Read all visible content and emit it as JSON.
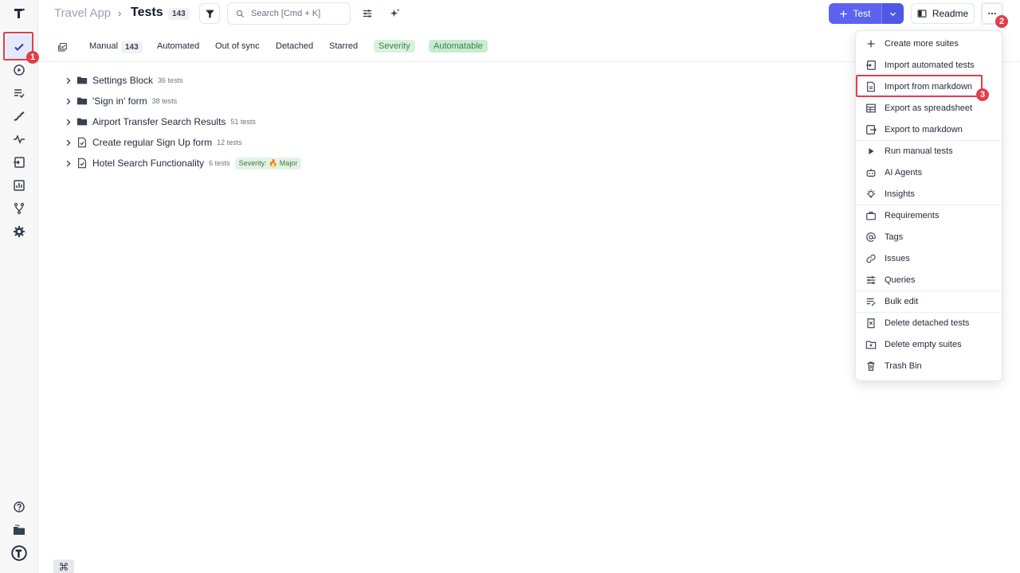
{
  "topbar": {
    "app_name": "Travel App",
    "separator": "›",
    "title": "Tests",
    "count": "143",
    "search_placeholder": "Search [Cmd + K]",
    "test_button": "Test",
    "readme_button": "Readme"
  },
  "tabs": {
    "manual": "Manual",
    "manual_count": "143",
    "automated": "Automated",
    "out_of_sync": "Out of sync",
    "detached": "Detached",
    "starred": "Starred",
    "severity": "Severity",
    "automatable": "Automatable"
  },
  "tree": [
    {
      "name": "Settings Block",
      "count": "36 tests",
      "type": "folder"
    },
    {
      "name": "'Sign in' form",
      "count": "38 tests",
      "type": "folder"
    },
    {
      "name": "Airport Transfer Search Results",
      "count": "51 tests",
      "type": "folder"
    },
    {
      "name": "Create regular Sign Up form",
      "count": "12 tests",
      "type": "file"
    },
    {
      "name": "Hotel Search Functionality",
      "count": "6 tests",
      "type": "file",
      "severity": "Severity: 🔥 Major"
    }
  ],
  "menu": {
    "items": [
      "Create more suites",
      "Import automated tests",
      "Import from markdown",
      "Export as spreadsheet",
      "Export to markdown",
      "Run manual tests",
      "AI Agents",
      "Insights",
      "Requirements",
      "Tags",
      "Issues",
      "Queries",
      "Bulk edit",
      "Delete detached tests",
      "Delete empty suites",
      "Trash Bin"
    ]
  },
  "markers": [
    "1",
    "2",
    "3"
  ],
  "kbd": "⌘",
  "colors": {
    "accent": "#5b63f0",
    "highlight": "#e43d4a",
    "tag_green": "#d8f2dd"
  }
}
